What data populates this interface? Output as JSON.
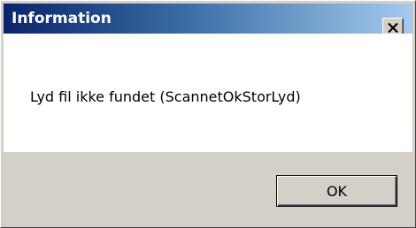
{
  "dialog": {
    "title": "Information",
    "message": "Lyd fil ikke fundet (ScannetOkStorLyd)",
    "ok_label": "OK",
    "close_icon": "close-icon"
  },
  "colors": {
    "titlebar_start": "#0a246a",
    "titlebar_end": "#a6caf0",
    "face": "#d4d0c8",
    "content_bg": "#ffffff"
  }
}
